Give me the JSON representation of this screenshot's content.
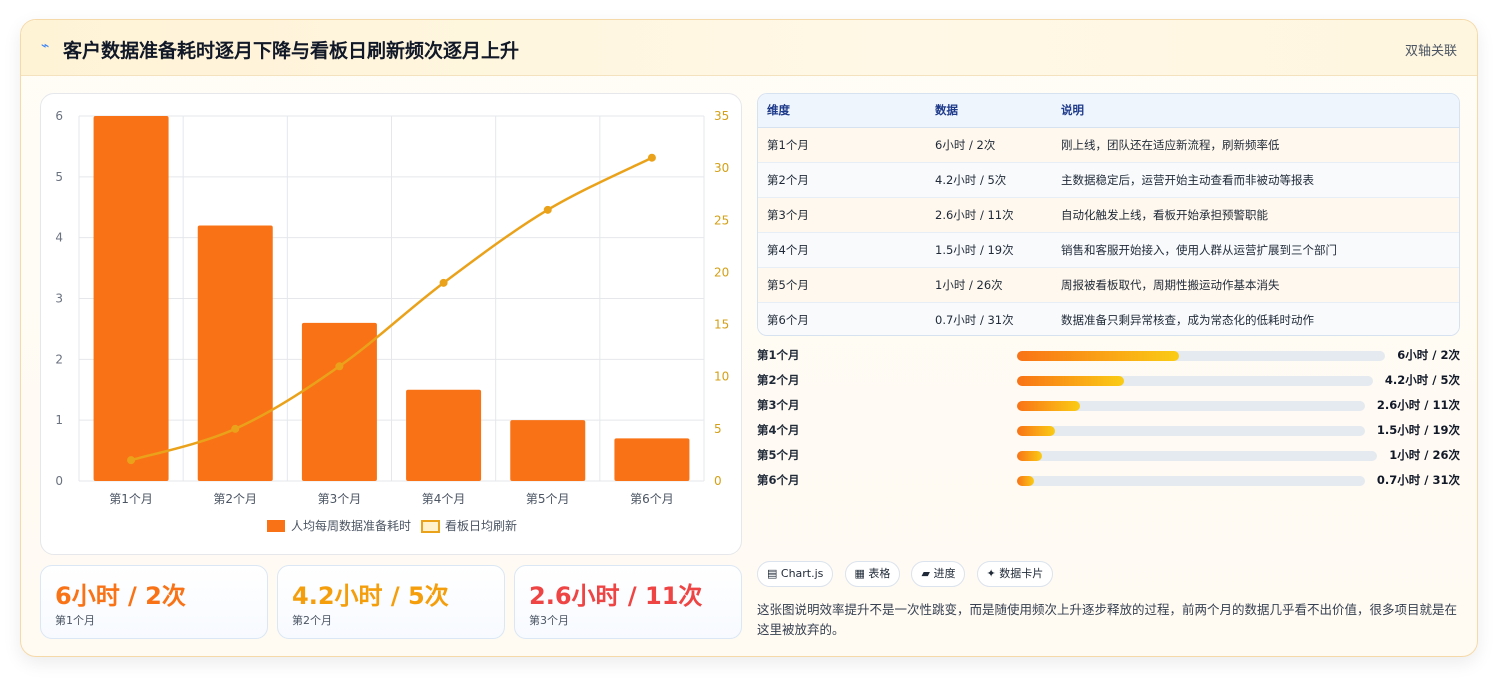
{
  "header": {
    "icon": "lightning-icon",
    "title": "客户数据准备耗时逐月下降与看板日刷新频次逐月上升",
    "tag": "双轴关联"
  },
  "chart_data": {
    "type": "bar",
    "categories": [
      "第1个月",
      "第2个月",
      "第3个月",
      "第4个月",
      "第5个月",
      "第6个月"
    ],
    "series": [
      {
        "name": "人均每周数据准备耗时",
        "type": "bar",
        "axis": "left",
        "color": "#f97316",
        "values": [
          6,
          4.2,
          2.6,
          1.5,
          1,
          0.7
        ]
      },
      {
        "name": "看板日均刷新",
        "type": "line",
        "axis": "right",
        "color": "#eaa21a",
        "values": [
          2,
          5,
          11,
          19,
          26,
          31
        ]
      }
    ],
    "y_left": {
      "ylim": [
        0,
        6
      ],
      "ticks": [
        "0",
        "1",
        "2",
        "3",
        "4",
        "5",
        "6"
      ]
    },
    "y_right": {
      "ylim": [
        0,
        35
      ],
      "ticks": [
        "0",
        "5",
        "10",
        "15",
        "20",
        "25",
        "30",
        "35"
      ]
    },
    "grid": true,
    "legend": "bottom"
  },
  "kpis": [
    {
      "value": "6小时 / 2次",
      "label": "第1个月",
      "color": "#f97316"
    },
    {
      "value": "4.2小时 / 5次",
      "label": "第2个月",
      "color": "#f59e0b"
    },
    {
      "value": "2.6小时 / 11次",
      "label": "第3个月",
      "color": "#ef4444"
    }
  ],
  "table": {
    "headers": [
      "维度",
      "数据",
      "说明"
    ],
    "rows": [
      [
        "第1个月",
        "6小时 / 2次",
        "刚上线，团队还在适应新流程，刷新频率低"
      ],
      [
        "第2个月",
        "4.2小时 / 5次",
        "主数据稳定后，运营开始主动查看而非被动等报表"
      ],
      [
        "第3个月",
        "2.6小时 / 11次",
        "自动化触发上线，看板开始承担预警职能"
      ],
      [
        "第4个月",
        "1.5小时 / 19次",
        "销售和客服开始接入，使用人群从运营扩展到三个部门"
      ],
      [
        "第5个月",
        "1小时 / 26次",
        "周报被看板取代，周期性搬运动作基本消失"
      ],
      [
        "第6个月",
        "0.7小时 / 31次",
        "数据准备只剩异常核查，成为常态化的低耗时动作"
      ]
    ]
  },
  "progress": [
    {
      "label": "第1个月",
      "value": "6小时 / 2次",
      "fraction": 0.44
    },
    {
      "label": "第2个月",
      "value": "4.2小时 / 5次",
      "fraction": 0.3
    },
    {
      "label": "第3个月",
      "value": "2.6小时 / 11次",
      "fraction": 0.18
    },
    {
      "label": "第4个月",
      "value": "1.5小时 / 19次",
      "fraction": 0.11
    },
    {
      "label": "第5个月",
      "value": "1小时 / 26次",
      "fraction": 0.07
    },
    {
      "label": "第6个月",
      "value": "0.7小时 / 31次",
      "fraction": 0.05
    }
  ],
  "chips": [
    "▤ Chart.js",
    "▦ 表格",
    "▰ 进度",
    "✦ 数据卡片"
  ],
  "note": "这张图说明效率提升不是一次性跳变，而是随使用频次上升逐步释放的过程，前两个月的数据几乎看不出价值，很多项目就是在这里被放弃的。"
}
